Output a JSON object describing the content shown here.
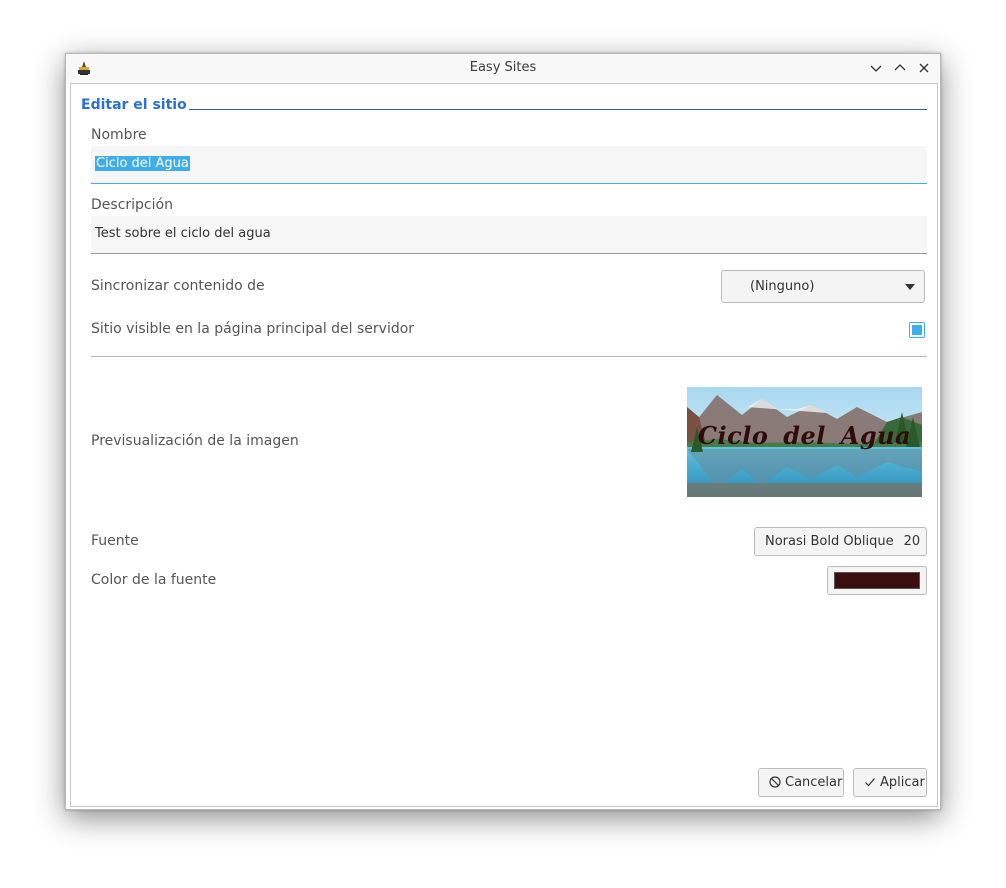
{
  "window": {
    "title": "Easy Sites",
    "controls": [
      "minimize-icon",
      "maximize-icon",
      "close-icon"
    ]
  },
  "form": {
    "group_title": "Editar el sitio",
    "name": {
      "label": "Nombre",
      "value": "Ciclo del Agua",
      "selected": true
    },
    "description": {
      "label": "Descripción",
      "value": "Test sobre el ciclo del agua"
    },
    "sync": {
      "label": "Sincronizar contenido de",
      "selected": "(Ninguno)"
    },
    "visible": {
      "label": "Sitio visible en la página principal del servidor",
      "checked": true
    },
    "preview": {
      "label": "Previsualización de la imagen",
      "caption": "Ciclo del Agua"
    },
    "font": {
      "label": "Fuente",
      "name": "Norasi Bold Oblique",
      "size": "20"
    },
    "font_color": {
      "label": "Color de la fuente",
      "value": "#3a0d0f"
    }
  },
  "buttons": {
    "cancel": "Cancelar",
    "apply": "Aplicar"
  },
  "colors": {
    "accent": "#3daee9",
    "group_title": "#2a70d0"
  }
}
